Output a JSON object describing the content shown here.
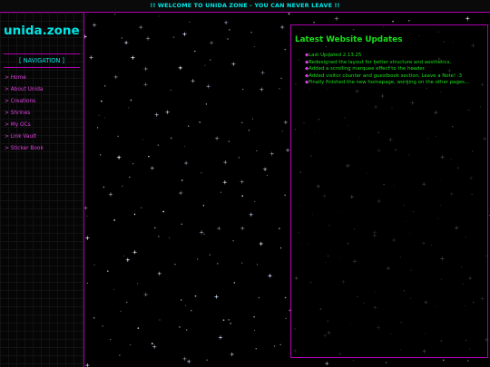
{
  "colors": {
    "accent_cyan": "#00e5e5",
    "accent_magenta": "#b000b0",
    "link_pink": "#e040e0",
    "update_green": "#19e019",
    "background": "#000000"
  },
  "marquee": {
    "text": "!! WELCOME TO UNIDA ZONE - YOU CAN NEVER LEAVE !!"
  },
  "sidebar": {
    "site_title": "unida.zone",
    "nav_header": "[ NAVIGATION ]",
    "items": [
      {
        "label": "> Home"
      },
      {
        "label": "> About Unida"
      },
      {
        "label": "> Creations"
      },
      {
        "label": "> Shrines"
      },
      {
        "label": "> My OCs"
      },
      {
        "label": "> Link Vault"
      },
      {
        "label": "> Sticker Book"
      }
    ]
  },
  "updates": {
    "title": "Latest Website Updates",
    "bullet_icon": "magenta-diamond",
    "items": [
      {
        "text": "Last Updated 2.13.25"
      },
      {
        "text": "Redesigned the layout for better structure and aesthetics."
      },
      {
        "text": "Added a scrolling marquee effect to the header."
      },
      {
        "text": "Added visitor counter and guestbook section. Leave a Note! :3"
      },
      {
        "text": "Finally finished the new homepage, working on the other pages..."
      }
    ]
  }
}
